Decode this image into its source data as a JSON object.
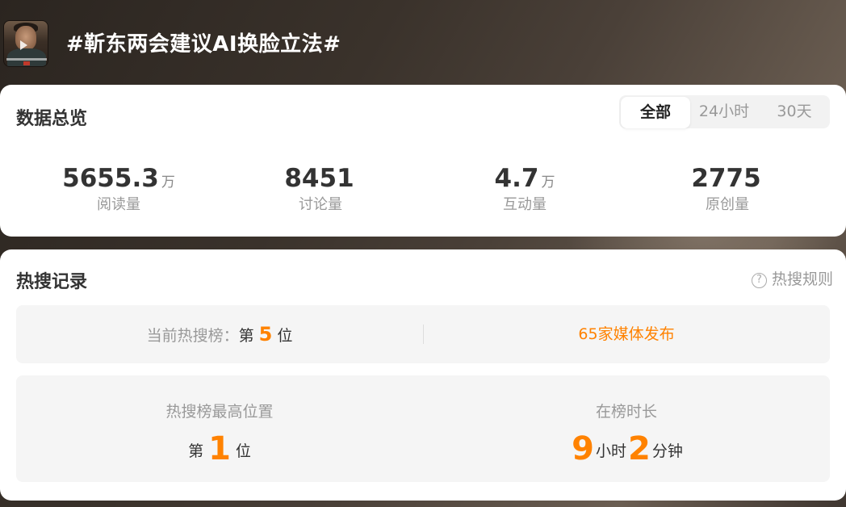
{
  "header": {
    "title": "#靳东两会建议AI换脸立法#"
  },
  "overview": {
    "title": "数据总览",
    "tabs": [
      "全部",
      "24小时",
      "30天"
    ],
    "active_tab": "全部",
    "stats": [
      {
        "value": "5655.3",
        "unit": "万",
        "label": "阅读量"
      },
      {
        "value": "8451",
        "unit": "",
        "label": "讨论量"
      },
      {
        "value": "4.7",
        "unit": "万",
        "label": "互动量"
      },
      {
        "value": "2775",
        "unit": "",
        "label": "原创量"
      }
    ]
  },
  "hot": {
    "title": "热搜记录",
    "rules_label": "热搜规则",
    "current": {
      "prefix": "当前热搜榜：",
      "rank_prefix": "第",
      "rank": "5",
      "rank_suffix": "位"
    },
    "media": "65家媒体发布",
    "highest": {
      "title": "热搜榜最高位置",
      "prefix": "第",
      "rank": "1",
      "suffix": "位"
    },
    "duration": {
      "title": "在榜时长",
      "hours": "9",
      "hours_unit": "小时",
      "minutes": "2",
      "minutes_unit": "分钟"
    }
  },
  "colors": {
    "accent": "#ff8200",
    "card_bg": "#ffffff",
    "box_bg": "#f5f5f5"
  },
  "icons": [
    "video-thumbnail",
    "question-circle-icon"
  ]
}
